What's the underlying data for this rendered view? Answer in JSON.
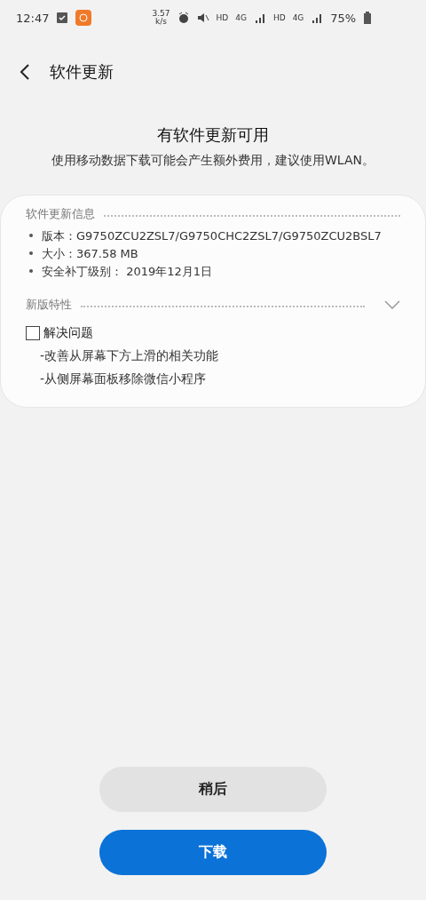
{
  "status_bar": {
    "time": "12:47",
    "speed_value": "3.57",
    "speed_unit": "k/s",
    "hd_labels": [
      "HD",
      "HD"
    ],
    "network_labels": [
      "4G",
      "4G"
    ],
    "battery": "75%"
  },
  "header": {
    "title": "软件更新"
  },
  "notice": {
    "title": "有软件更新可用",
    "message": "使用移动数据下载可能会产生额外费用，建议使用WLAN。"
  },
  "info_section": {
    "title": "软件更新信息",
    "items": [
      "版本：G9750ZCU2ZSL7/G9750CHC2ZSL7/G9750ZCU2BSL7",
      "大小：367.58 MB",
      "安全补丁级别： 2019年12月1日"
    ]
  },
  "features_section": {
    "title": "新版特性",
    "groups": [
      {
        "label": "解决问题",
        "checked": false,
        "lines": [
          "-改善从屏幕下方上滑的相关功能",
          "-从侧屏幕面板移除微信小程序"
        ]
      }
    ]
  },
  "buttons": [
    {
      "label": "稍后",
      "kind": "secondary"
    },
    {
      "label": "下载",
      "kind": "primary"
    }
  ]
}
